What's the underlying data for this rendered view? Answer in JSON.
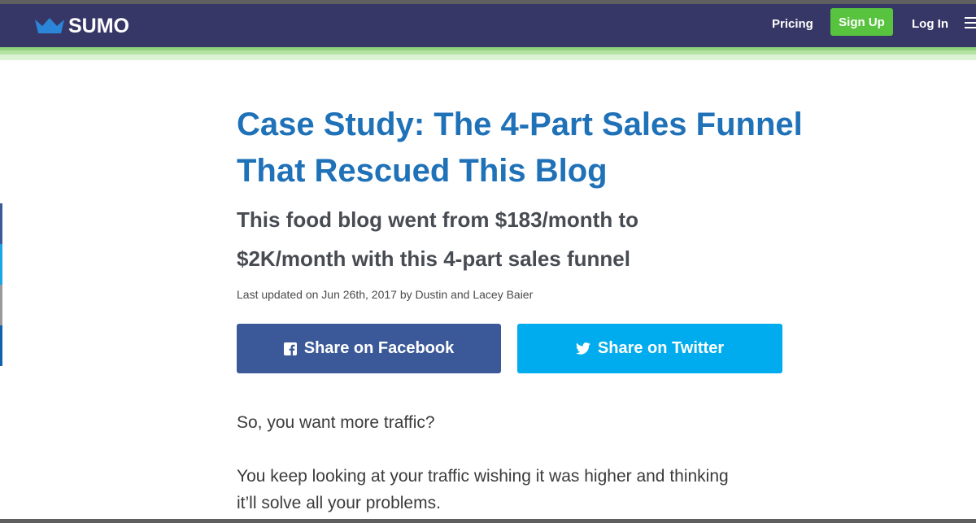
{
  "header": {
    "logo_text": "SUMO",
    "logo_icon": "crown-icon",
    "nav": {
      "pricing": "Pricing",
      "signup": "Sign Up",
      "login": "Log In",
      "menu_icon": "hamburger-menu-icon"
    }
  },
  "article": {
    "title_line1": "Case Study: The 4-Part Sales Funnel",
    "title_line2": "That Rescued This Blog",
    "subtitle_line1": "This food blog went from $183/month to",
    "subtitle_line2": "$2K/month with this 4-part sales funnel",
    "byline": "Last updated on Jun 26th, 2017 by Dustin and Lacey Baier",
    "share_facebook": "Share on Facebook",
    "share_twitter": "Share on Twitter",
    "paragraph1": "So, you want more traffic?",
    "paragraph2_line1": "You keep looking at your traffic wishing it was higher and thinking",
    "paragraph2_line2": "it’ll solve all your problems."
  },
  "colors": {
    "navbar_bg": "#363766",
    "signup_green": "#58c33e",
    "title_blue": "#1f71b8",
    "facebook_blue": "#3b5998",
    "twitter_blue": "#00aced"
  },
  "side_share_icons": [
    "facebook-icon",
    "twitter-icon",
    "share-icon",
    "linkedin-icon"
  ]
}
